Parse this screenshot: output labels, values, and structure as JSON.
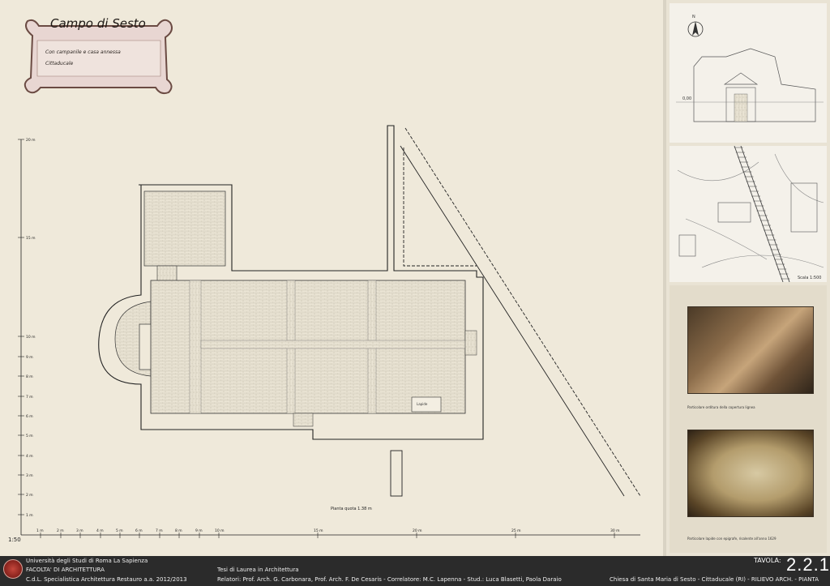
{
  "drawing": {
    "scale_label": "1:50",
    "plan_caption": "Pianta quota 1.38 m",
    "vertical_ticks": [
      "1 m",
      "2 m",
      "3 m",
      "4 m",
      "5 m",
      "6 m",
      "7 m",
      "8 m",
      "9 m",
      "10 m",
      "15 m",
      "20 m"
    ],
    "horizontal_ticks": [
      "1 m",
      "2 m",
      "3 m",
      "4 m",
      "5 m",
      "6 m",
      "7 m",
      "8 m",
      "9 m",
      "10 m",
      "15 m",
      "20 m",
      "25 m",
      "30 m"
    ],
    "inscription_label": "Lapide"
  },
  "cartouche": {
    "title": "Campo di Sesto",
    "line1": "Con campanile e casa annessa",
    "line2": "Cittaducale"
  },
  "side": {
    "north": "N",
    "elevation_mark": "0,00",
    "map_scale": "Scala 1:500",
    "photo1_caption": "Particolare orditura della copertura lignea",
    "photo2_caption": "Particolare lapide con epigrafe, risalente all'anno 1629"
  },
  "footer": {
    "university": "Università degli Studi di Roma La Sapienza",
    "faculty": "FACOLTA' DI ARCHITETTURA",
    "course": "C.d.L. Specialistica Architettura Restauro a.a. 2012/2013",
    "thesis": "Tesi  di Laurea  in Architettura",
    "credits": "Relatori: Prof. Arch. G. Carbonara, Prof. Arch. F. De Cesaris - Correlatore: M.C. Lapenna - Stud.: Luca Blasetti, Paola Daraio",
    "tavola_label": "TAVOLA:",
    "tavola_number": "2.2.1",
    "subject": "Chiesa di Santa Maria di Sesto - Cittaducale (RI) - RILIEVO ARCH. - PIANTA"
  }
}
